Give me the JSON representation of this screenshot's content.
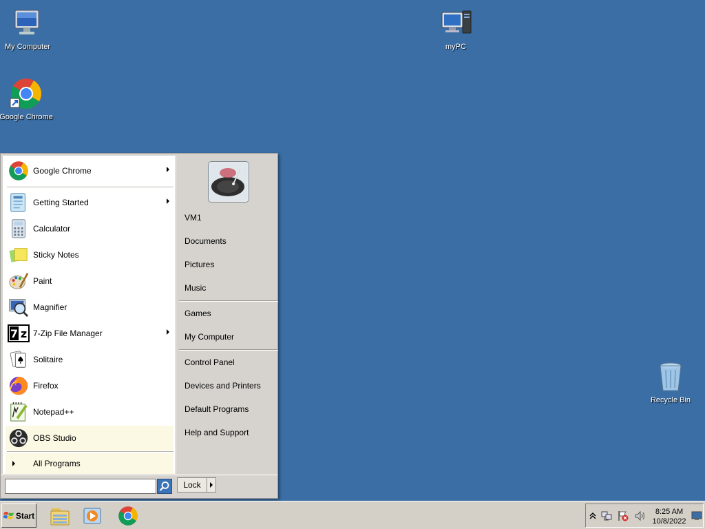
{
  "desktop": {
    "icons": [
      {
        "label": "My Computer",
        "icon": "monitor-icon"
      },
      {
        "label": "Google Chrome",
        "icon": "chrome-icon"
      },
      {
        "label": "myPC",
        "icon": "computer-icon"
      },
      {
        "label": "Recycle Bin",
        "icon": "recycle-bin-icon"
      }
    ],
    "background_color": "#3a6ea5"
  },
  "start_menu": {
    "pinned": {
      "label": "Google Chrome",
      "icon": "chrome-icon"
    },
    "programs": [
      {
        "label": "Getting Started",
        "icon": "getting-started-icon",
        "submenu": true
      },
      {
        "label": "Calculator",
        "icon": "calculator-icon",
        "submenu": false
      },
      {
        "label": "Sticky Notes",
        "icon": "sticky-notes-icon",
        "submenu": false
      },
      {
        "label": "Paint",
        "icon": "paint-icon",
        "submenu": false
      },
      {
        "label": "Magnifier",
        "icon": "magnifier-icon",
        "submenu": false
      },
      {
        "label": "7-Zip File Manager",
        "icon": "7zip-icon",
        "submenu": true
      },
      {
        "label": "Solitaire",
        "icon": "solitaire-icon",
        "submenu": false
      },
      {
        "label": "Firefox",
        "icon": "firefox-icon",
        "submenu": false
      },
      {
        "label": "Notepad++",
        "icon": "notepadpp-icon",
        "submenu": false
      },
      {
        "label": "OBS Studio",
        "icon": "obs-icon",
        "submenu": false
      }
    ],
    "all_programs": "All Programs",
    "right": {
      "user": "VM1",
      "group1": [
        "Documents",
        "Pictures",
        "Music"
      ],
      "group2": [
        "Games",
        "My Computer"
      ],
      "group3": [
        "Control Panel",
        "Devices and Printers",
        "Default Programs",
        "Help and Support"
      ]
    },
    "search": {
      "value": "",
      "placeholder": ""
    },
    "lock_label": "Lock"
  },
  "taskbar": {
    "start_label": "Start",
    "pinned": [
      "file-explorer-icon",
      "media-player-icon",
      "chrome-icon"
    ],
    "tray": {
      "icons": [
        "show-hidden-icon",
        "network-icon",
        "action-center-icon",
        "volume-icon"
      ],
      "time": "8:25 AM",
      "date": "10/8/2022"
    }
  }
}
